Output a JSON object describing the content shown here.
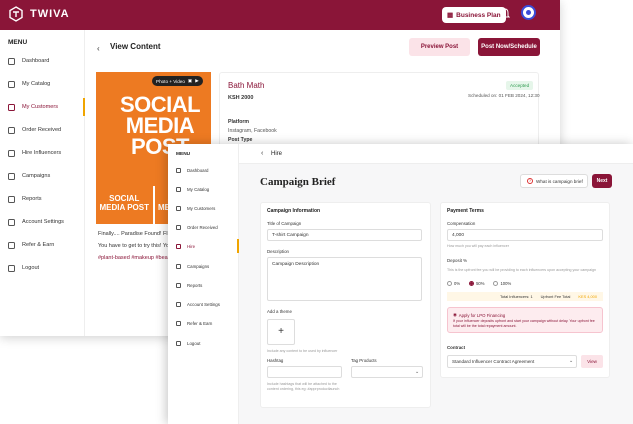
{
  "brand": {
    "name": "TWIVA",
    "accent": "#8a1538",
    "highlight": "#f0a500"
  },
  "header": {
    "plan_label": "Business Plan"
  },
  "sidebar": {
    "title": "MENU",
    "items": [
      {
        "label": "Dashboard",
        "icon": "grid-icon"
      },
      {
        "label": "My Catalog",
        "icon": "catalog-icon"
      },
      {
        "label": "My Customers",
        "icon": "users-icon"
      },
      {
        "label": "Order Received",
        "icon": "order-icon"
      },
      {
        "label": "Hire Influencers",
        "icon": "hire-icon"
      },
      {
        "label": "Campaigns",
        "icon": "campaign-icon"
      },
      {
        "label": "Reports",
        "icon": "reports-icon"
      },
      {
        "label": "Account Settings",
        "icon": "gear-icon"
      },
      {
        "label": "Refer & Earn",
        "icon": "share-icon"
      },
      {
        "label": "Logout",
        "icon": "logout-icon"
      }
    ]
  },
  "view_content": {
    "title": "View Content",
    "preview_label": "Preview Post",
    "post_label": "Post Now/Schedule",
    "media_badge": "Photo + Video",
    "media_text": "SOCIAL MEDIA POST",
    "thumb_text": "SOCIAL MEDIA POST",
    "caption_line1": "Finally.... Paradise Found! Flipp",
    "caption_line2": "You have to get to try this! You",
    "caption_tags": "#plant-based #makeup #beau",
    "product_name": "Bath Math",
    "price": "KSH 2000",
    "status": "Accepted",
    "scheduled": "Scheduled on: 01 FEB 2024, 12:30",
    "platform_label": "Platform",
    "platform_value": "Instagram, Facebook",
    "post_type_label": "Post Type"
  },
  "hire_window": {
    "sidebar_title": "MENU",
    "sidebar_items": [
      {
        "label": "Dashboard",
        "icon": "grid-icon"
      },
      {
        "label": "My Catalog",
        "icon": "catalog-icon"
      },
      {
        "label": "My Customers",
        "icon": "users-icon"
      },
      {
        "label": "Order Received",
        "icon": "order-icon"
      },
      {
        "label": "Hire",
        "icon": "hire-icon"
      },
      {
        "label": "Campaigns",
        "icon": "campaign-icon"
      },
      {
        "label": "Reports",
        "icon": "reports-icon"
      },
      {
        "label": "Account Settings",
        "icon": "gear-icon"
      },
      {
        "label": "Refer & Earn",
        "icon": "share-icon"
      },
      {
        "label": "Logout",
        "icon": "logout-icon"
      }
    ],
    "breadcrumb": "Hire",
    "page_title": "Campaign Brief",
    "what_label": "What is campaign brief",
    "next_label": "Next",
    "campaign_info": {
      "heading": "Campaign Information",
      "title_label": "Title of Campaign",
      "title_value": "T-shirt Campaign",
      "desc_label": "Description",
      "desc_value": "Campaign Description",
      "theme_label": "Add a theme",
      "theme_hint": "Include any content to be used by influencer",
      "hashtag_label": "Hashtag",
      "hashtag_hint": "Include hashtags that will be attached to the content ordering, this eg: #apprproductlaunch",
      "tag_products_label": "Tag Products"
    },
    "payment": {
      "heading": "Payment Terms",
      "compensation_label": "Compensation",
      "compensation_value": "4,000",
      "compensation_hint": "How much you will pay each influencer",
      "deposit_label": "Deposit %",
      "deposit_hint": "This is the upfront fee you will be providing to each influencers upon accepting your campaign",
      "options": [
        "0%",
        "50%",
        "100%"
      ],
      "selected_option": "50%",
      "total_influencers": "Total Influencers: 1",
      "upfront_label": "Upfront Fee Total",
      "upfront_value": "KES 4,000",
      "lpo_title": "Apply for LPO Financing",
      "lpo_text": "If your influencer deposits upfront and start your campaign without delay. Your upfront fee total will be the total repayment amount.",
      "contract_label": "Contract",
      "contract_value": "Standard Influencer Contract Agreement",
      "view_label": "View"
    }
  }
}
